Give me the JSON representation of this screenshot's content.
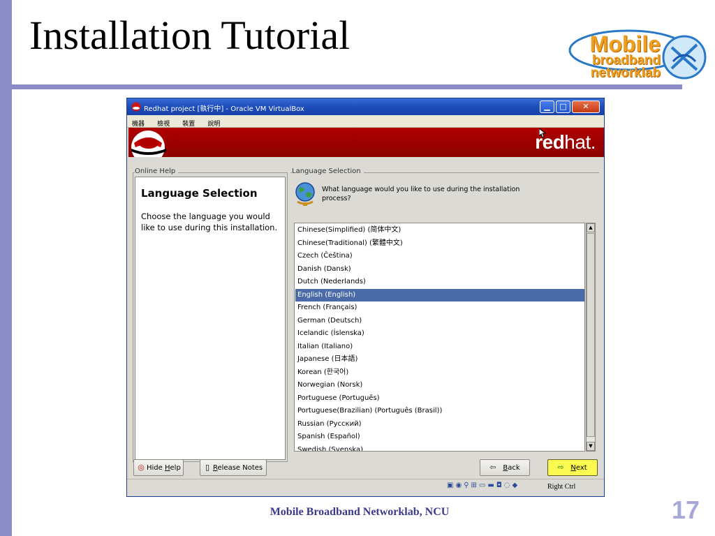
{
  "slide": {
    "title": "Installation Tutorial",
    "logo_lines": [
      "Mobile",
      "broadband",
      "networklab"
    ],
    "footer": "Mobile Broadband Networklab, NCU",
    "page_number": "17"
  },
  "vm": {
    "window_title": "Redhat project [執行中] - Oracle VM VirtualBox",
    "menu": [
      "機器",
      "檢視",
      "裝置",
      "說明"
    ],
    "status_host_key": "Right Ctrl",
    "window_controls": [
      "minimize-icon",
      "maximize-icon",
      "close-icon"
    ]
  },
  "banner": {
    "word_bold": "red",
    "word_light": "hat."
  },
  "help": {
    "frame_label": "Online Help",
    "title": "Language Selection",
    "body": "Choose the language you would like to use during this installation."
  },
  "language": {
    "frame_label": "Language Selection",
    "question": "What language would you like to use during the installation process?",
    "selected_index": 5,
    "items": [
      "Chinese(Simplified) (简体中文)",
      "Chinese(Traditional) (繁體中文)",
      "Czech (Čeština)",
      "Danish (Dansk)",
      "Dutch (Nederlands)",
      "English (English)",
      "French (Français)",
      "German (Deutsch)",
      "Icelandic (Íslenska)",
      "Italian (Italiano)",
      "Japanese (日本語)",
      "Korean (한국어)",
      "Norwegian (Norsk)",
      "Portuguese (Português)",
      "Portuguese(Brazilian) (Português (Brasil))",
      "Russian (Русский)",
      "Spanish (Español)",
      "Swedish (Svenska)"
    ]
  },
  "buttons": {
    "hide_help_prefix": "Hide ",
    "hide_help_key": "H",
    "hide_help_suffix": "elp",
    "release_key": "R",
    "release_suffix": "elease Notes",
    "back_key": "B",
    "back_suffix": "ack",
    "next_key": "N",
    "next_suffix": "ext"
  },
  "colors": {
    "slide_accent": "#8c8cc8",
    "banner_red": "#a00000",
    "selection": "#4a6ba8",
    "next_highlight": "#fafa50"
  }
}
